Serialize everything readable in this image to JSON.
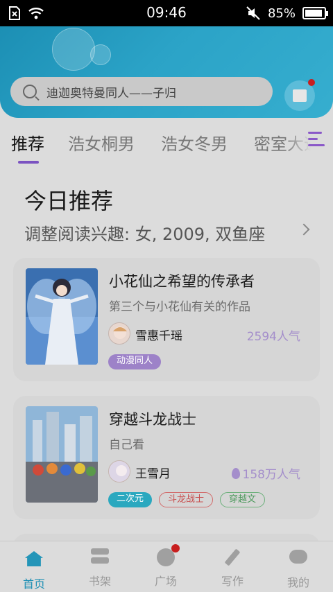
{
  "status_bar": {
    "time": "09:46",
    "battery": "85%",
    "battery_level": 0.85,
    "icons": [
      "sim-error-icon",
      "wifi-icon",
      "mute-icon",
      "battery-icon"
    ]
  },
  "search": {
    "placeholder": "迪迦奥特曼同人——子归"
  },
  "tabs": [
    {
      "label": "推荐",
      "active": true
    },
    {
      "label": "浩女桐男",
      "active": false
    },
    {
      "label": "浩女冬男",
      "active": false
    },
    {
      "label": "密室大逃",
      "active": false
    }
  ],
  "today": {
    "title": "今日推荐",
    "subtitle": "调整阅读兴趣: 女, 2009, 双鱼座"
  },
  "books": [
    {
      "title": "小花仙之希望的传承者",
      "description": "第三个与小花仙有关的作品",
      "author": "雪惠千瑶",
      "popularity": "2594人气",
      "hot": false,
      "tags": [
        {
          "label": "动漫同人",
          "style": "fill-purple"
        }
      ]
    },
    {
      "title": "穿越斗龙战士",
      "description": "自己看",
      "author": "王雪月",
      "popularity": "158万人气",
      "hot": true,
      "tags": [
        {
          "label": "二次元",
          "style": "fill-teal"
        },
        {
          "label": "斗龙战士",
          "style": "outline-red"
        },
        {
          "label": "穿越文",
          "style": "outline-green"
        }
      ]
    }
  ],
  "bottom_nav": [
    {
      "label": "首页",
      "icon": "home-icon",
      "active": true
    },
    {
      "label": "书架",
      "icon": "bookshelf-icon",
      "active": false
    },
    {
      "label": "广场",
      "icon": "plaza-icon",
      "active": false,
      "badge": true
    },
    {
      "label": "写作",
      "icon": "pen-icon",
      "active": false
    },
    {
      "label": "我的",
      "icon": "profile-icon",
      "active": false
    }
  ],
  "colors": {
    "accent": "#7b53c1",
    "header": "#2ba3c7",
    "badge": "#c81e1e"
  }
}
